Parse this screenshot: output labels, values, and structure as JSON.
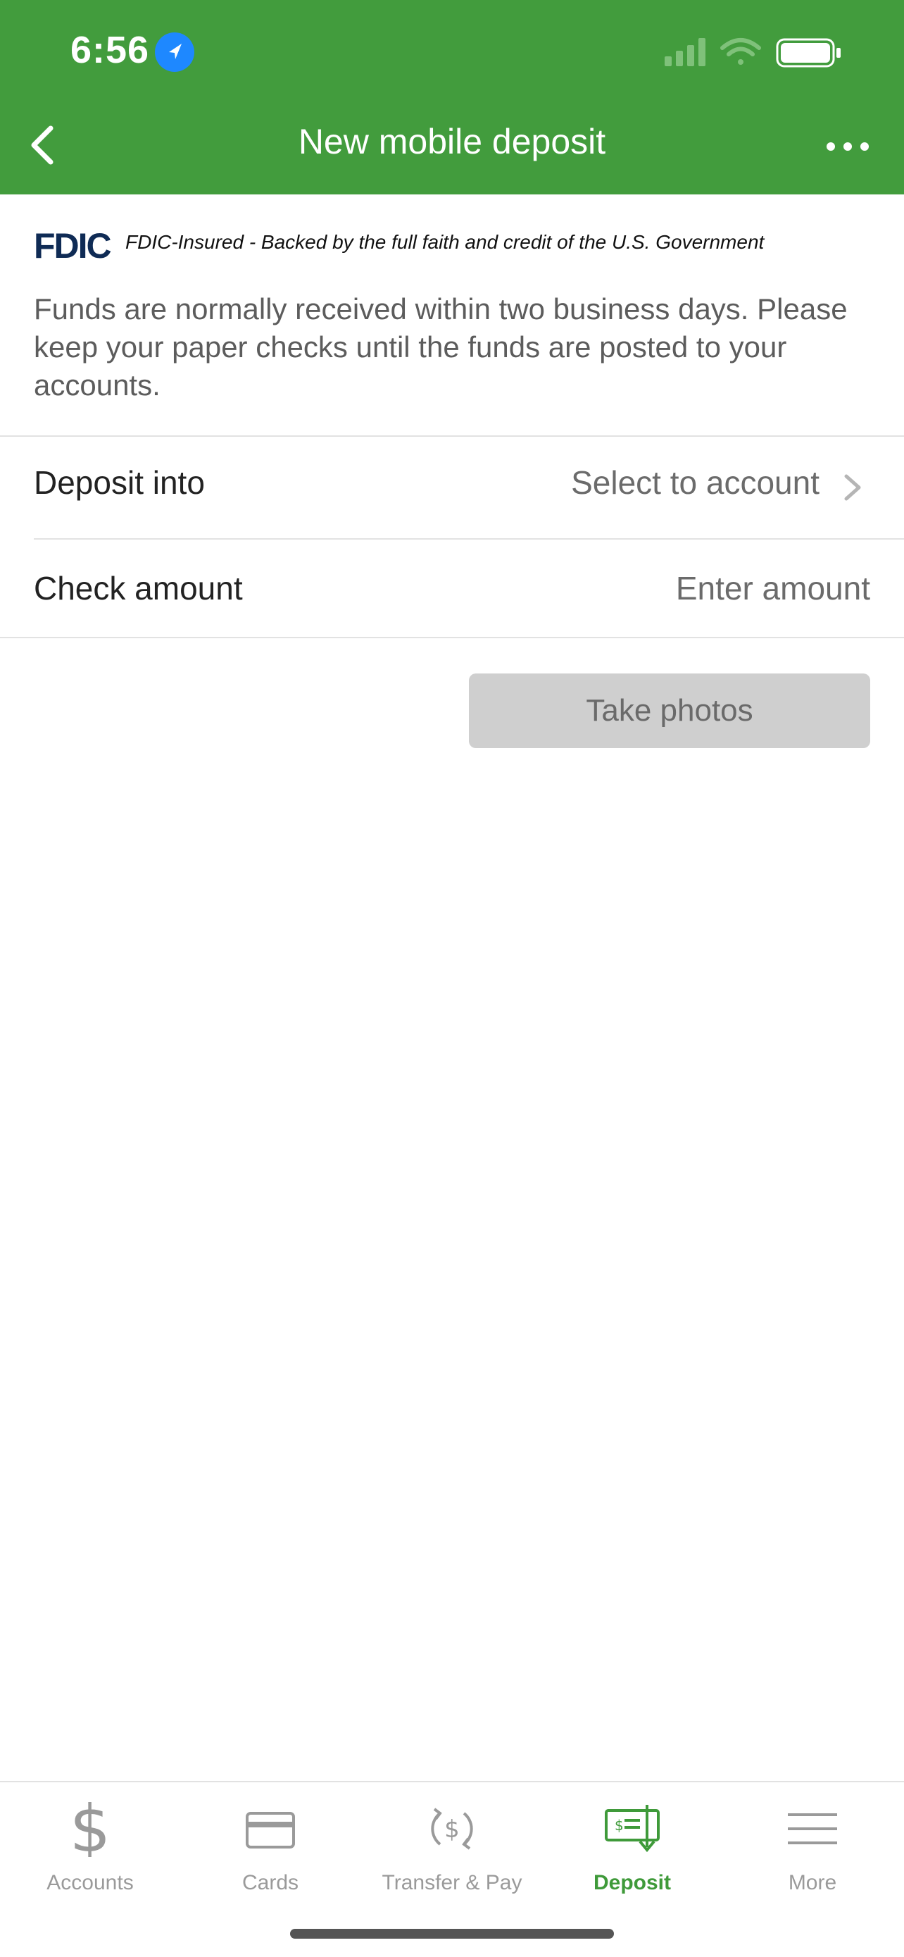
{
  "status": {
    "time": "6:56"
  },
  "header": {
    "title": "New mobile deposit"
  },
  "fdic": {
    "logo": "FDIC",
    "text": "FDIC-Insured - Backed by the full faith and credit of the U.S. Government"
  },
  "info": {
    "text": "Funds are normally received within two business days. Please keep your paper checks until the funds are posted to your accounts."
  },
  "form": {
    "deposit_into": {
      "label": "Deposit into",
      "value": "Select to account"
    },
    "check_amount": {
      "label": "Check amount",
      "placeholder": "Enter amount"
    }
  },
  "actions": {
    "take_photos": "Take photos"
  },
  "tabs": [
    {
      "label": "Accounts",
      "icon": "dollar-icon"
    },
    {
      "label": "Cards",
      "icon": "card-icon"
    },
    {
      "label": "Transfer & Pay",
      "icon": "transfer-icon"
    },
    {
      "label": "Deposit",
      "icon": "check-deposit-icon",
      "active": true
    },
    {
      "label": "More",
      "icon": "menu-icon"
    }
  ],
  "colors": {
    "brand": "#429c3d",
    "active_tab": "#3f9a3a",
    "disabled_button": "#cfcfcf"
  }
}
